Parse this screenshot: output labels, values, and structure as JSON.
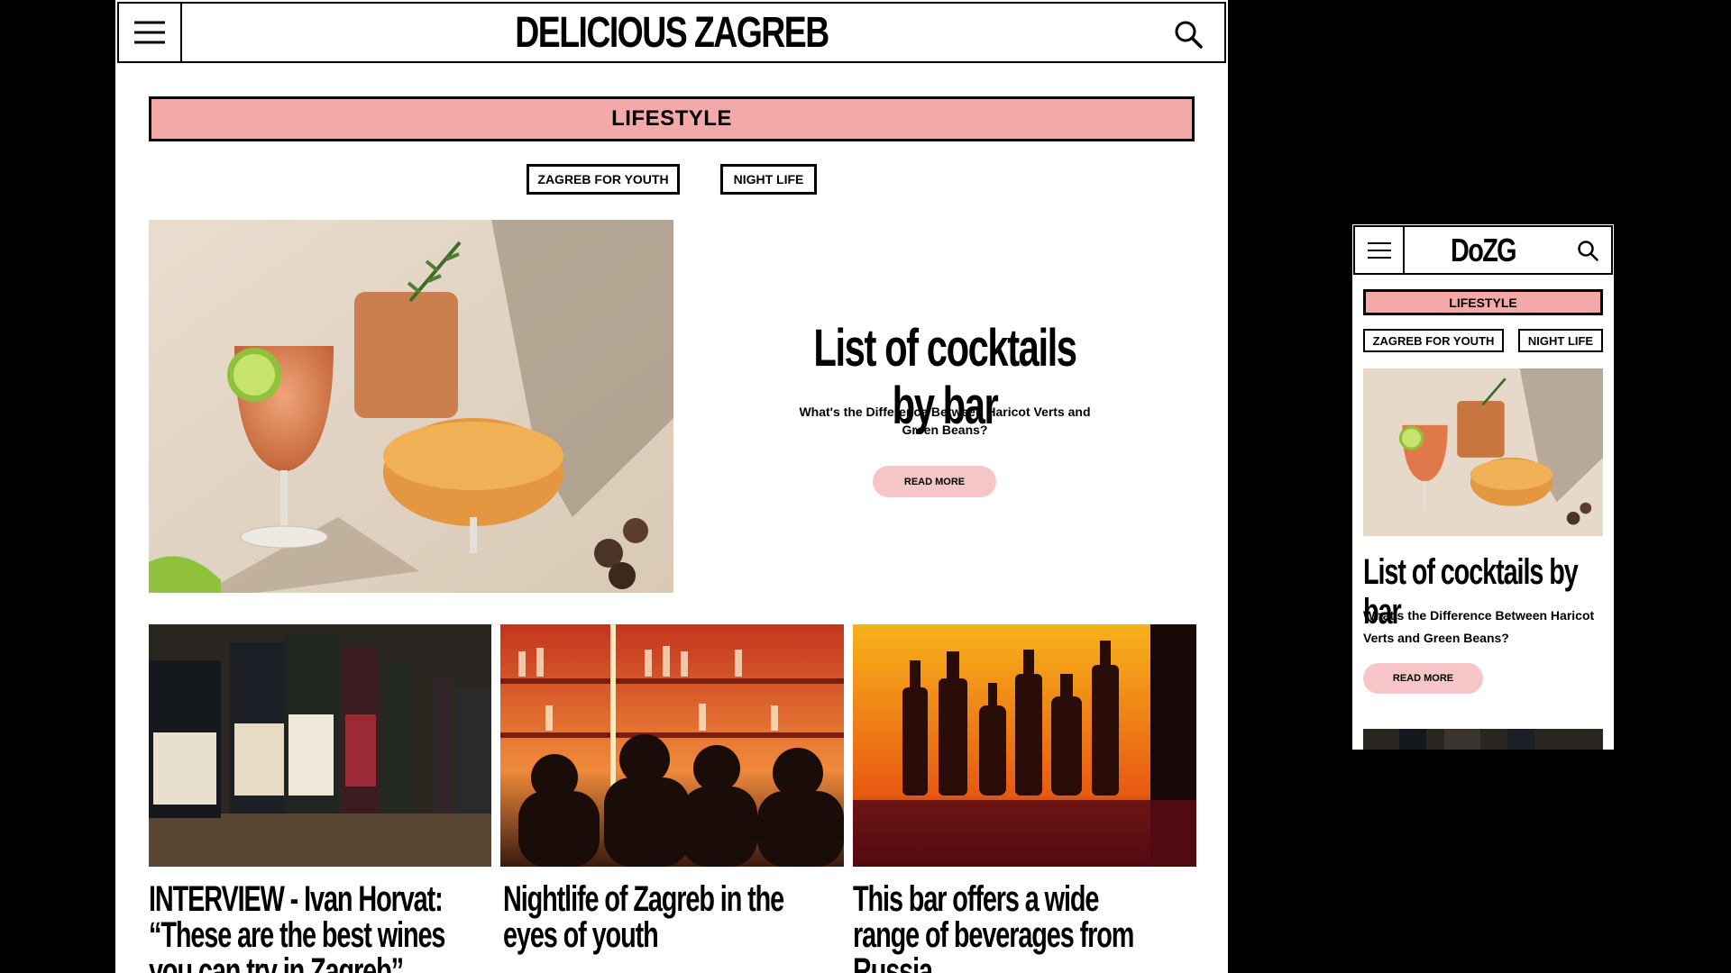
{
  "colors": {
    "accent_pink": "#f2a9a8",
    "button_pink": "#f5c5c8",
    "background": "#000000"
  },
  "desktop": {
    "header": {
      "logo": "DELICIOUS ZAGREB",
      "menu_icon": "hamburger-menu-icon",
      "search_icon": "search-icon"
    },
    "category": "LIFESTYLE",
    "tags": [
      "ZAGREB FOR YOUTH",
      "NIGHT LIFE"
    ],
    "hero": {
      "title": "List of cocktails by bar",
      "subtitle": "What's the Difference Between Haricot Verts and Green Beans?",
      "button": "READ MORE",
      "image": "cocktail-glasses-photo"
    },
    "cards": [
      {
        "title": "INTERVIEW - Ivan Horvat: “These are the best wines you can try in Zagreb”",
        "image": "wine-bottles-shelf-photo"
      },
      {
        "title": "Nightlife of Zagreb in the eyes of youth",
        "image": "bar-crowd-photo"
      },
      {
        "title": "This bar offers a wide range of beverages from Russia",
        "image": "bottles-silhouette-photo"
      }
    ]
  },
  "mobile": {
    "header": {
      "logo": "DoZG",
      "menu_icon": "hamburger-menu-icon",
      "search_icon": "search-icon"
    },
    "category": "LIFESTYLE",
    "tags": [
      "ZAGREB FOR YOUTH",
      "NIGHT LIFE"
    ],
    "hero": {
      "title": "List of cocktails by bar",
      "subtitle": "What's the Difference Between Haricot Verts and Green Beans?",
      "button": "READ MORE"
    }
  }
}
